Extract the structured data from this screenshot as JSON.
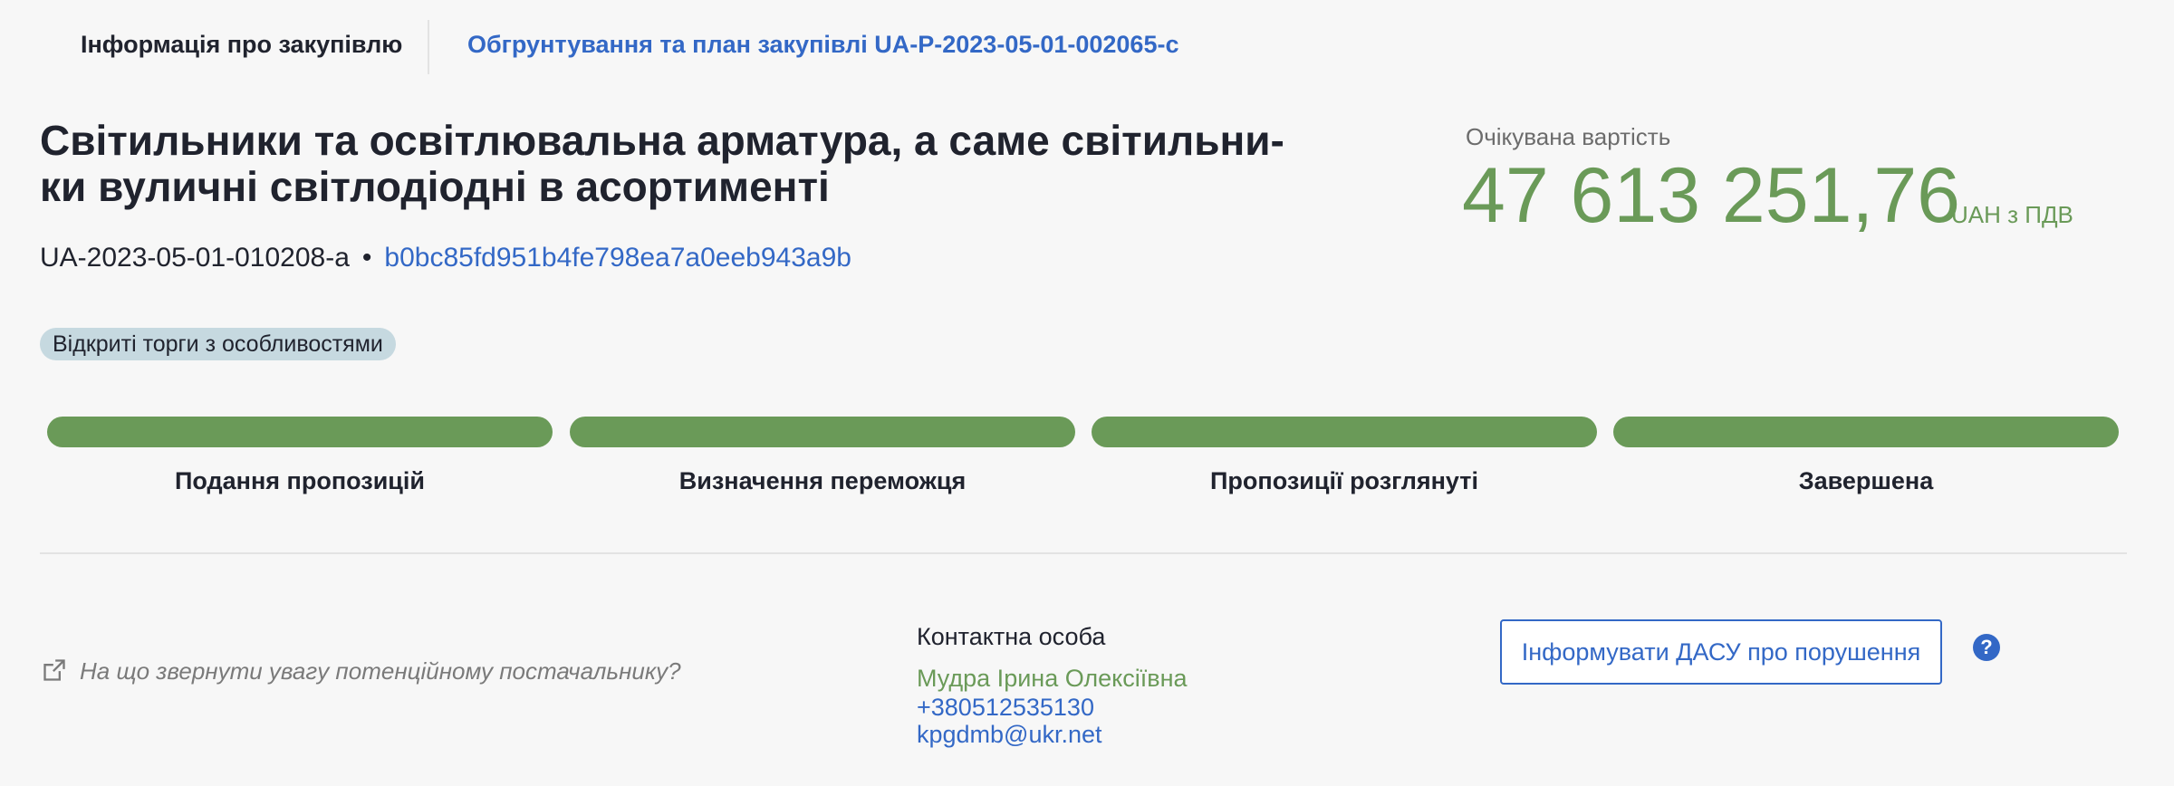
{
  "tabs": {
    "info": "Інформація про закупівлю",
    "plan": "Обгрунтування та план закупівлі UA-P-2023-05-01-002065-c"
  },
  "tender": {
    "title": "Світильники та освітлювальна арматура, а саме світильни-ки вуличні світлодіодні в асортименті",
    "id": "UA-2023-05-01-010208-a",
    "separator": "•",
    "hash": "b0bc85fd951b4fe798ea7a0eeb943a9b",
    "procedure_type": "Відкриті торги з особливостями"
  },
  "expected_value": {
    "label": "Очікувана вартість",
    "amount": "47 613 251,76",
    "currency": "UAH з ПДВ"
  },
  "stages": [
    {
      "label": "Подання пропозицій",
      "progress": 1.0
    },
    {
      "label": "Визначення переможця",
      "progress": 1.0
    },
    {
      "label": "Пропозиції розглянуті",
      "progress": 1.0
    },
    {
      "label": "Завершена",
      "progress": 1.0
    }
  ],
  "supplier_hint": {
    "icon": "external-link-icon",
    "text": "На що звернути увагу потенційному постачальнику?"
  },
  "contact": {
    "label": "Контактна особа",
    "name": "Мудра Ірина Олексіївна",
    "phone": "+380512535130",
    "email": "kpgdmb@ukr.net"
  },
  "report": {
    "button_label": "Інформувати ДАСУ про порушення",
    "help_icon": "help-icon",
    "help_glyph": "?"
  },
  "colors": {
    "accent": "#3368c6",
    "success": "#6a9a58",
    "badge_bg": "#c6d9e0"
  }
}
